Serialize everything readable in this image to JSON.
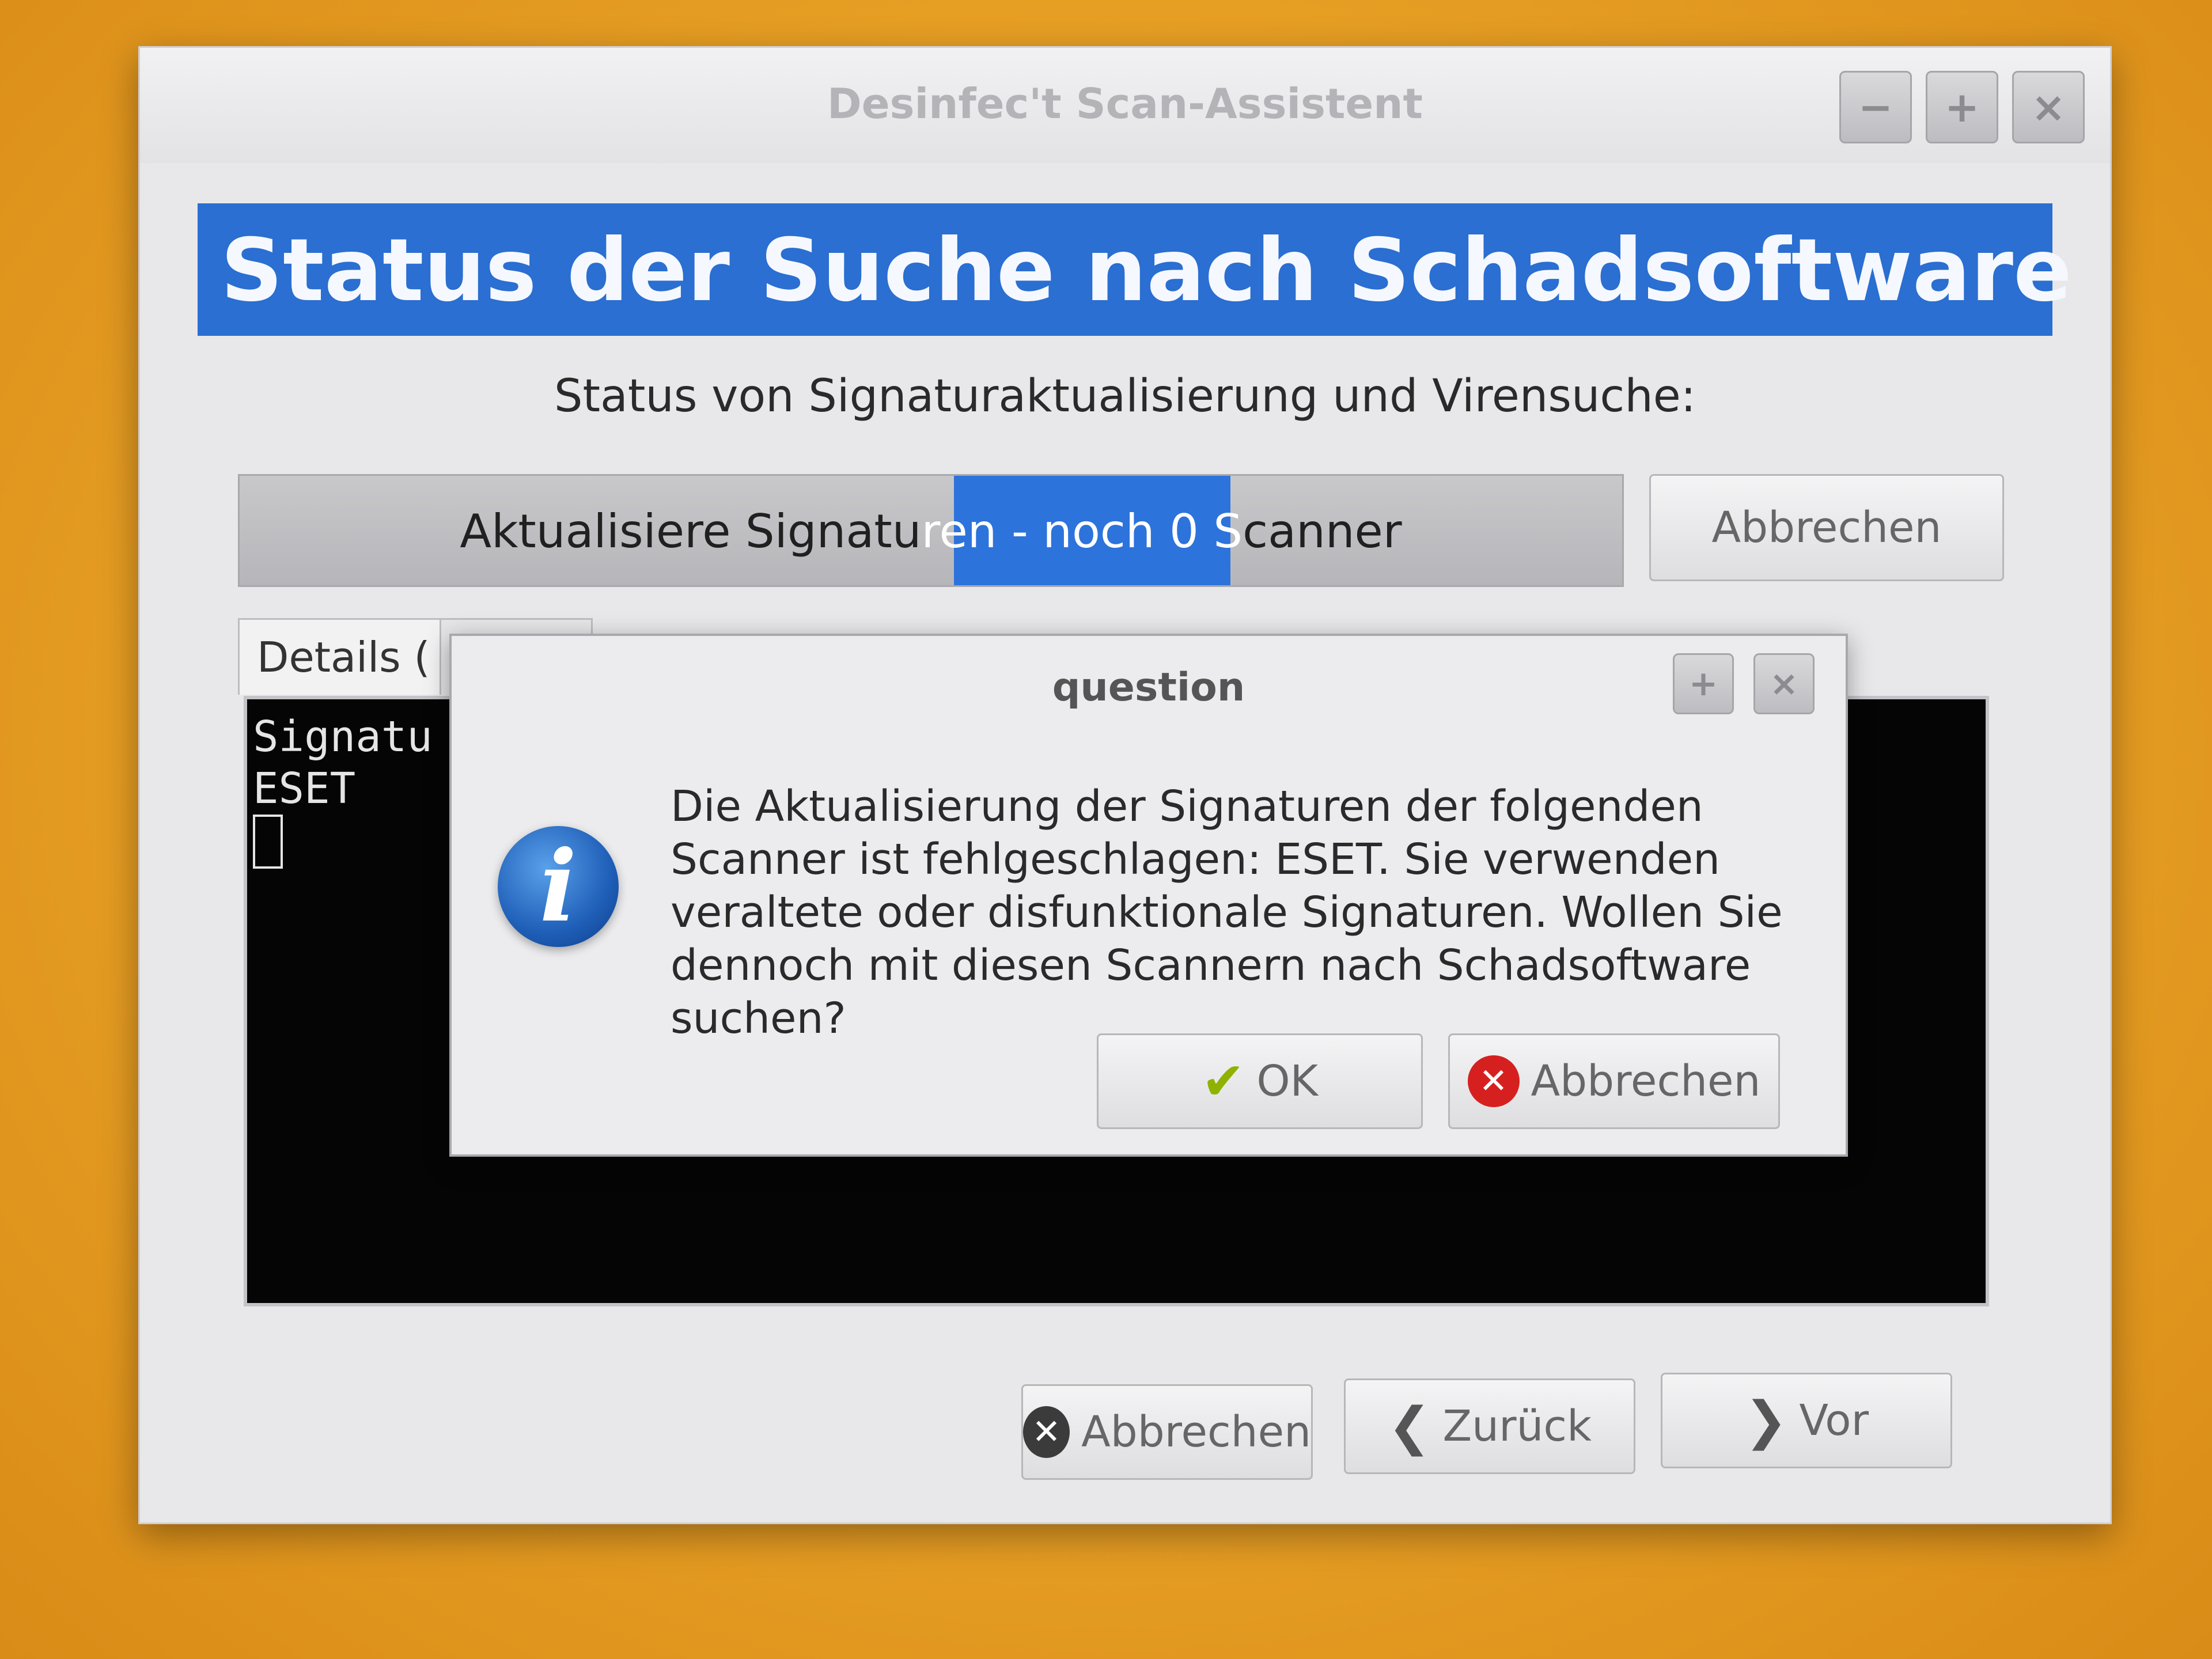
{
  "window": {
    "title": "Desinfec't Scan-Assistent",
    "controls": {
      "minimize": "−",
      "maximize": "+",
      "close": "×"
    }
  },
  "header": {
    "title": "Status der Suche nach Schadsoftware"
  },
  "status": {
    "caption": "Status von Signaturaktualisierung und Virensuche:",
    "progress_text_before": "Aktualisiere Signatu",
    "progress_text_highlight": "ren - noch 0 S",
    "progress_text_after": "canner",
    "cancel_label": "Abbrechen"
  },
  "tabs": [
    {
      "label": "Details ("
    }
  ],
  "console": {
    "lines": [
      "Signatu",
      "ESET"
    ]
  },
  "dialog": {
    "title": "question",
    "controls": {
      "maximize": "+",
      "close": "×"
    },
    "icon": "info-icon",
    "message": "Die Aktualisierung der Signaturen der folgenden Scanner ist fehlgeschlagen: ESET. Sie verwenden veraltete oder disfunktionale Signaturen. Wollen Sie dennoch mit diesen Scannern nach Schadsoftware suchen?",
    "ok_label": "OK",
    "cancel_label": "Abbrechen"
  },
  "footer": {
    "cancel_label": "Abbrechen",
    "back_label": "Zurück",
    "forward_label": "Vor"
  },
  "colors": {
    "banner": "#2a6fd1",
    "progress_fill": "#2d73dc",
    "background": "#e79f24"
  }
}
